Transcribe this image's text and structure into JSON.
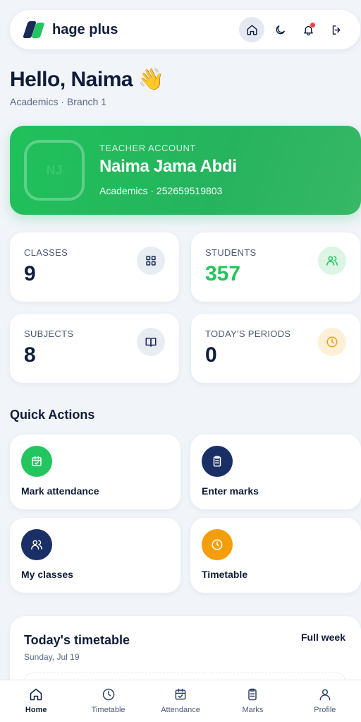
{
  "app": {
    "name": "hage plus"
  },
  "header": {
    "icons": [
      "home-icon",
      "moon-icon",
      "bell-icon",
      "logout-icon"
    ],
    "notification_dot_color": "#ef4444"
  },
  "greeting": {
    "title": "Hello, Naima",
    "emoji": "👋",
    "subtitle": "Academics · Branch 1"
  },
  "teacher_card": {
    "label": "TEACHER ACCOUNT",
    "initials": "NJ",
    "name": "Naima Jama Abdi",
    "meta": "Academics · 252659519803",
    "color": "#22c55e"
  },
  "stats": [
    {
      "label": "CLASSES",
      "value": "9",
      "icon": "grid-icon",
      "value_color": "#0f1c3a"
    },
    {
      "label": "STUDENTS",
      "value": "357",
      "icon": "users-icon",
      "value_color": "#22c55e"
    },
    {
      "label": "SUBJECTS",
      "value": "8",
      "icon": "book-icon",
      "value_color": "#0f1c3a"
    },
    {
      "label": "TODAY'S PERIODS",
      "value": "0",
      "icon": "clock-icon",
      "value_color": "#0f1c3a"
    }
  ],
  "quick_actions": {
    "title": "Quick Actions",
    "items": [
      {
        "label": "Mark attendance",
        "icon": "calendar-check-icon",
        "color": "#22c55e"
      },
      {
        "label": "Enter marks",
        "icon": "clipboard-icon",
        "color": "#1a2f66"
      },
      {
        "label": "My classes",
        "icon": "users-icon",
        "color": "#1a2f66"
      },
      {
        "label": "Timetable",
        "icon": "clock-icon",
        "color": "#f59e0b"
      }
    ]
  },
  "timetable": {
    "title": "Today's timetable",
    "date": "Sunday, Jul 19",
    "link": "Full week"
  },
  "bottom_nav": [
    {
      "label": "Home",
      "icon": "home-icon",
      "active": true
    },
    {
      "label": "Timetable",
      "icon": "clock-icon",
      "active": false
    },
    {
      "label": "Attendance",
      "icon": "calendar-check-icon",
      "active": false
    },
    {
      "label": "Marks",
      "icon": "clipboard-icon",
      "active": false
    },
    {
      "label": "Profile",
      "icon": "user-icon",
      "active": false
    }
  ]
}
